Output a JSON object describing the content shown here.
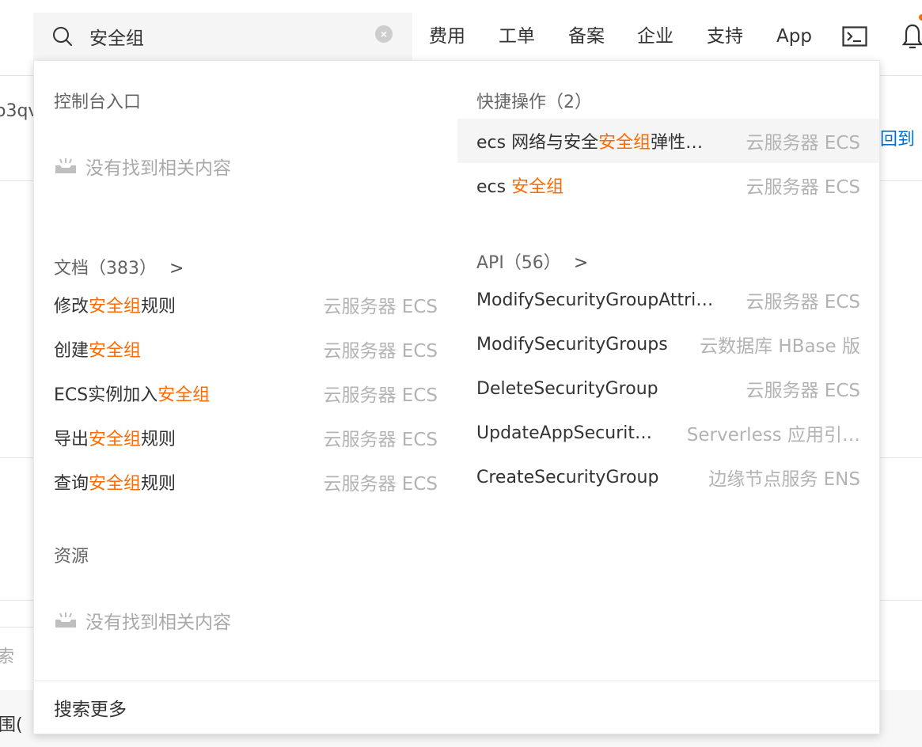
{
  "search": {
    "value": "安全组"
  },
  "nav": [
    "费用",
    "工单",
    "备案",
    "企业",
    "支持",
    "App"
  ],
  "background": {
    "left_fragment_1": "o3qv",
    "right_link": "回到",
    "left_fragment_2": "索",
    "left_fragment_3": "围("
  },
  "console": {
    "title": "控制台入口",
    "empty": "没有找到相关内容"
  },
  "quick": {
    "title": "快捷操作（2）",
    "items": [
      {
        "pre": "ecs 网络与安全",
        "hit": "安全组",
        "post": "弹性…",
        "tag": "云服务器 ECS"
      },
      {
        "pre": "ecs ",
        "hit": "安全组",
        "post": "",
        "tag": "云服务器 ECS"
      }
    ]
  },
  "docs": {
    "title": "文档（383）",
    "items": [
      {
        "pre": "修改",
        "hit": "安全组",
        "post": "规则",
        "tag": "云服务器 ECS"
      },
      {
        "pre": "创建",
        "hit": "安全组",
        "post": "",
        "tag": "云服务器 ECS"
      },
      {
        "pre": "ECS实例加入",
        "hit": "安全组",
        "post": "",
        "tag": "云服务器 ECS"
      },
      {
        "pre": "导出",
        "hit": "安全组",
        "post": "规则",
        "tag": "云服务器 ECS"
      },
      {
        "pre": "查询",
        "hit": "安全组",
        "post": "规则",
        "tag": "云服务器 ECS"
      }
    ]
  },
  "api": {
    "title": "API（56）",
    "items": [
      {
        "name": "ModifySecurityGroupAttrib…",
        "tag": "云服务器 ECS"
      },
      {
        "name": "ModifySecurityGroups",
        "tag": "云数据库 HBase 版"
      },
      {
        "name": "DeleteSecurityGroup",
        "tag": "云服务器 ECS"
      },
      {
        "name": "UpdateAppSecurity…",
        "tag": "Serverless 应用引…"
      },
      {
        "name": "CreateSecurityGroup",
        "tag": "边缘节点服务 ENS"
      }
    ]
  },
  "resources": {
    "title": "资源",
    "empty": "没有找到相关内容"
  },
  "more_label": "搜索更多",
  "colors": {
    "accent": "#ff6a00",
    "link": "#0070cc",
    "muted": "#b3b3b3"
  }
}
